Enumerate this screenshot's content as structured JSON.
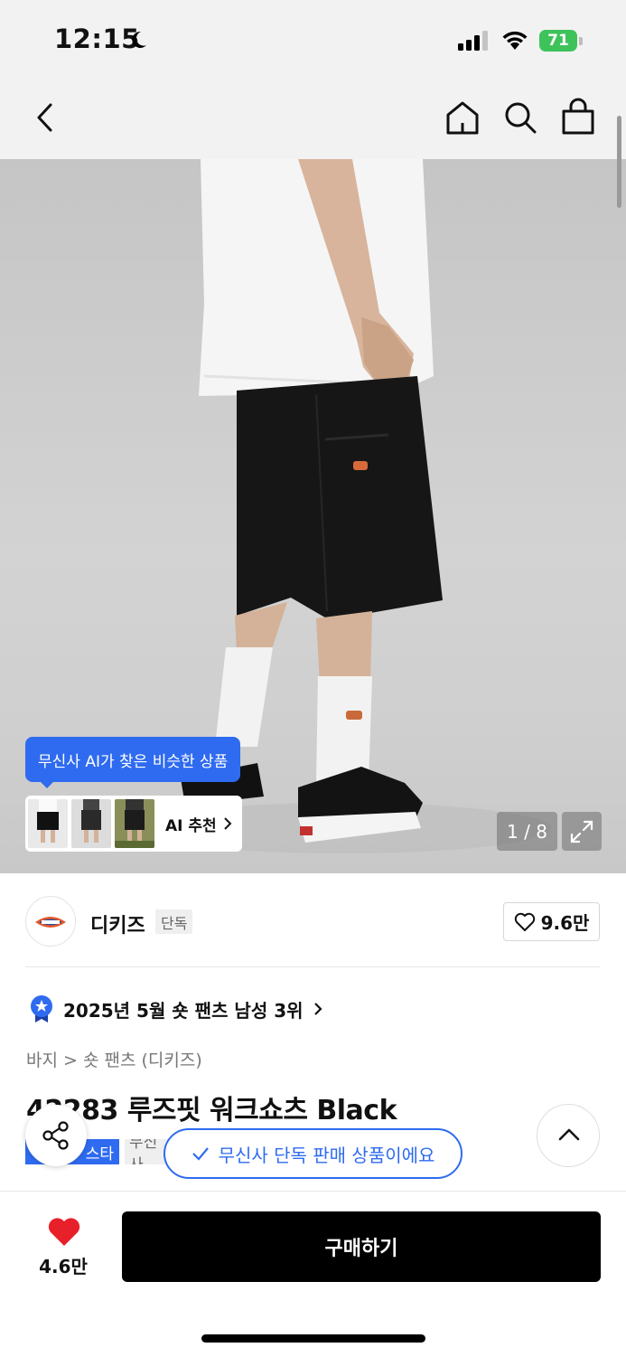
{
  "status_bar": {
    "time": "12:15",
    "battery": "71"
  },
  "nav": {
    "icons": [
      "back-icon",
      "home-icon",
      "search-icon",
      "shopping-bag-icon"
    ]
  },
  "gallery": {
    "ai_bubble_text": "무신사 AI가 찾은 비슷한 상품",
    "ai_reco_label": "AI 추천",
    "counter": "1 / 8"
  },
  "brand": {
    "name": "디키즈",
    "tag": "단독",
    "like_count": "9.6만"
  },
  "ranking": {
    "text": "2025년 5월 숏 팬츠 남성 3위"
  },
  "breadcrumb": {
    "text": "바지 > 숏 팬츠 (디키즈)"
  },
  "product": {
    "title": "42283 루즈핏 워크쇼츠 Black",
    "tag_blue": "스타",
    "tag_gray": "무신사"
  },
  "toast": {
    "text": "무신사 단독 판매 상품이에요"
  },
  "bottom": {
    "wish_count": "4.6만",
    "buy_label": "구매하기"
  },
  "colors": {
    "accent": "#2f6bf0",
    "heart": "#e8202a",
    "buy_bg": "#000000"
  }
}
